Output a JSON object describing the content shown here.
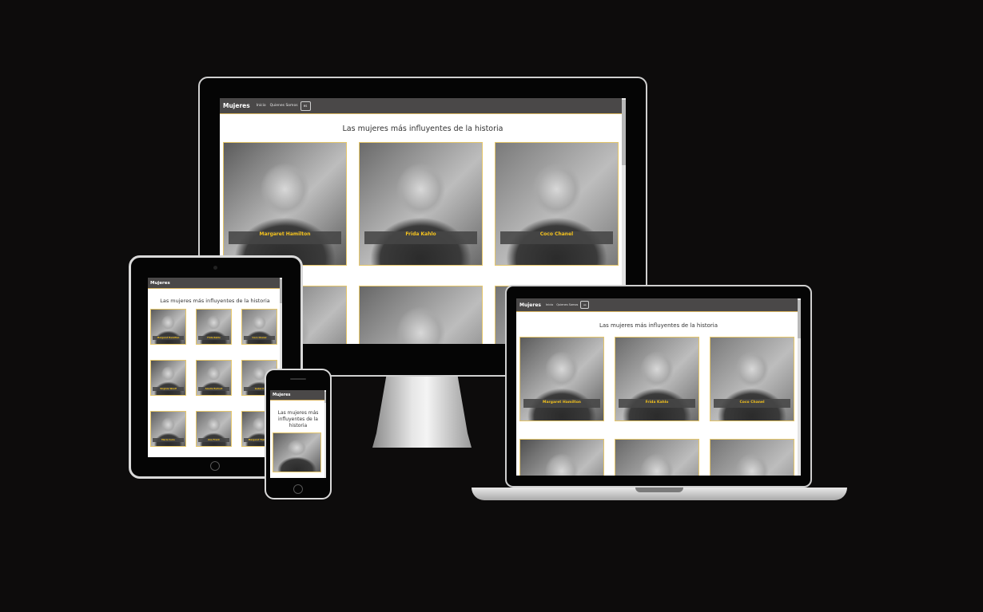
{
  "site": {
    "brand": "Mujeres",
    "nav": [
      "Inicio",
      "Quienes Somos"
    ],
    "lang": "es",
    "heading": "Las mujeres más influyentes de la historia"
  },
  "cards": [
    {
      "name": "Margaret Hamilton"
    },
    {
      "name": "Frida Kahlo"
    },
    {
      "name": "Coco Chanel"
    },
    {
      "name": "Virginia Woolf"
    },
    {
      "name": "Amelia Earhart"
    },
    {
      "name": "Isabel II"
    },
    {
      "name": "Marie Curie"
    },
    {
      "name": "Ana Frank"
    },
    {
      "name": "Margaret Thatcher"
    }
  ],
  "colors": {
    "accent": "#f4c21d",
    "nav": "#4a4848",
    "border": "#e6c76a"
  }
}
